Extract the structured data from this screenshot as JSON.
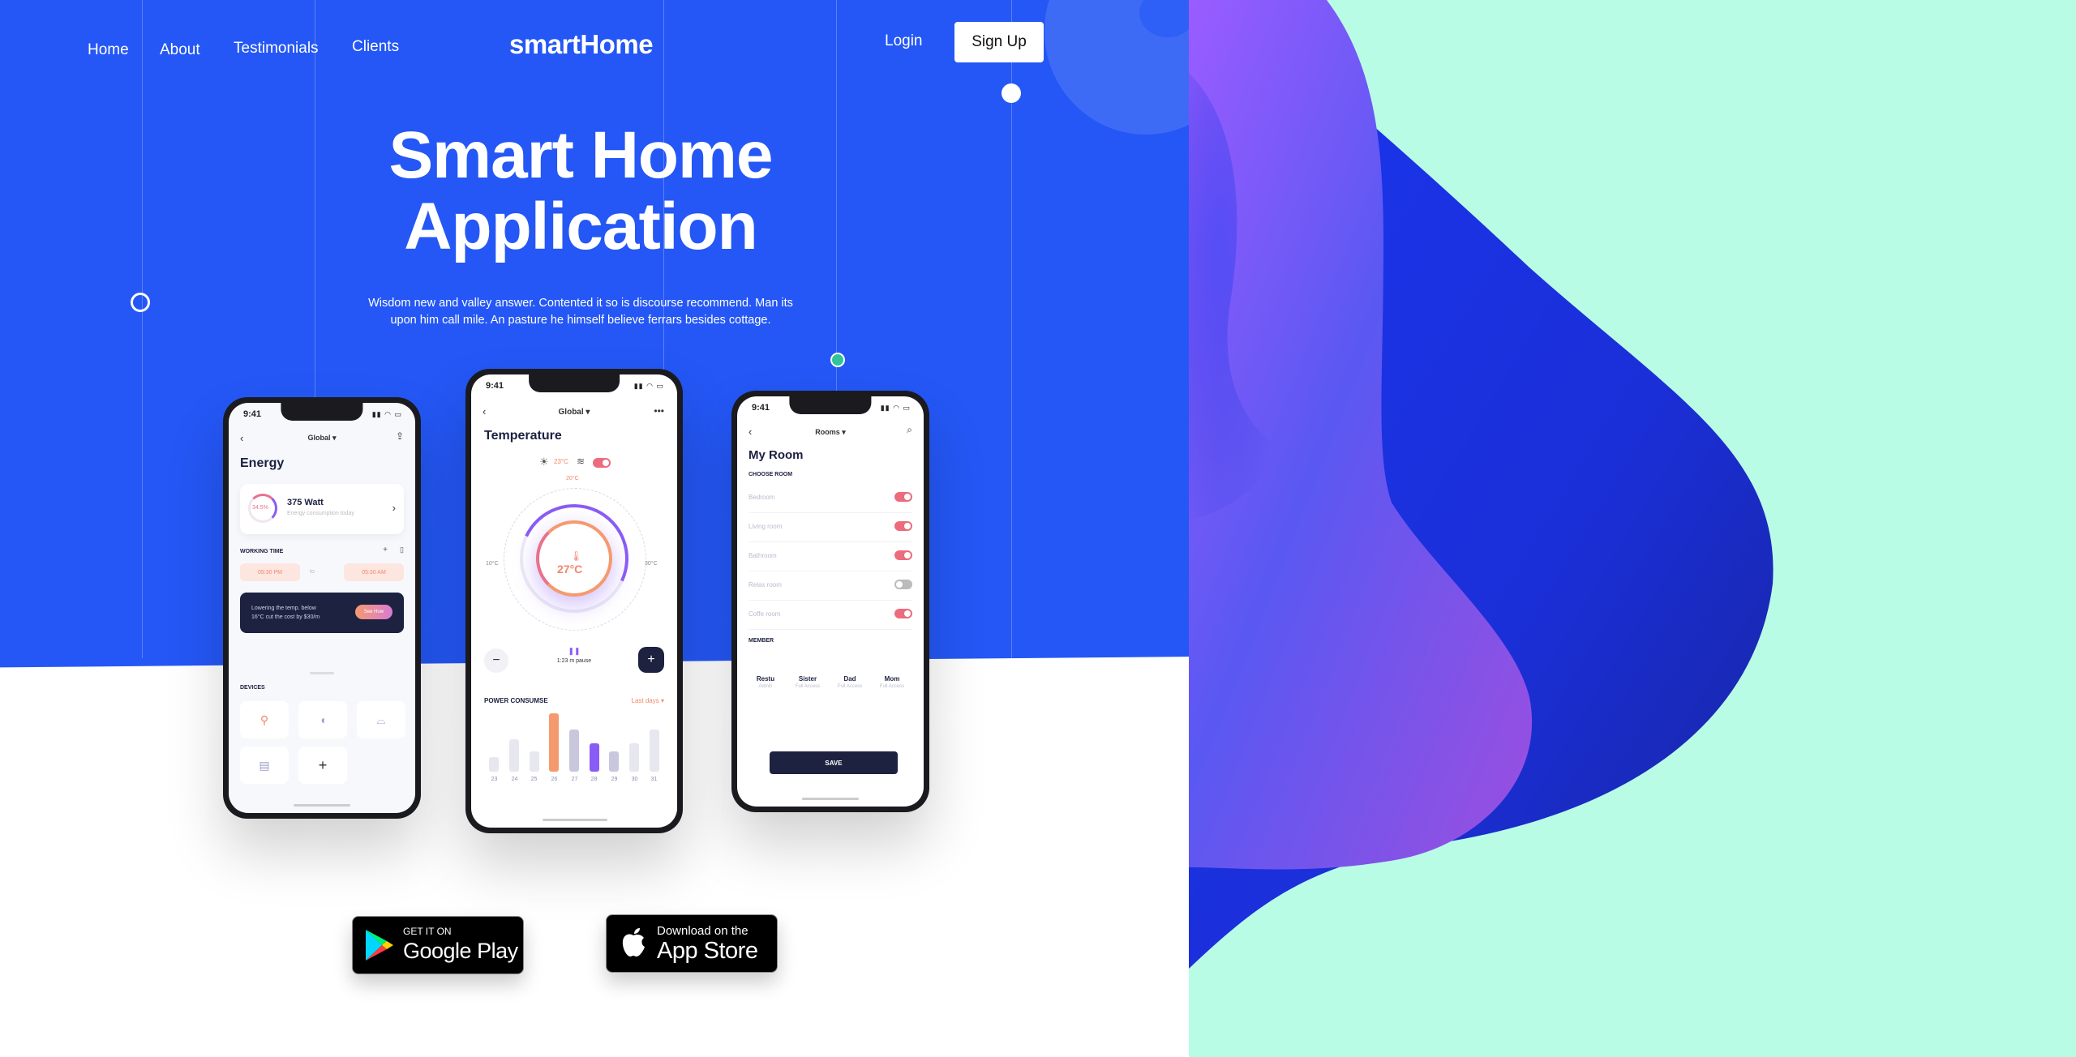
{
  "nav": {
    "home": "Home",
    "about": "About",
    "testimonials": "Testimonials",
    "clients": "Clients",
    "brand": "smartHome",
    "login": "Login",
    "signup": "Sign Up"
  },
  "hero": {
    "title_line1": "Smart Home",
    "title_line2": "Application",
    "subtitle_line1": "Wisdom new and valley answer. Contented it so is discourse recommend. Man its",
    "subtitle_line2": "upon him call mile. An pasture he himself believe ferrars besides cottage."
  },
  "phone_left": {
    "time": "9:41",
    "location": "Global",
    "heading": "Energy",
    "energy_percent": "34.5%",
    "energy_value": "375 Watt",
    "energy_sub": "Energy consumption today",
    "working_time": "WORKING TIME",
    "time_from": "09:30 PM",
    "time_to_label": "to",
    "time_to": "05:30 AM",
    "tip_line1": "Lowering the temp. below",
    "tip_line2": "16°C cut the cost by $30/m",
    "tip_button": "See How",
    "devices": "DEVICES"
  },
  "phone_mid": {
    "time": "9:41",
    "location": "Global",
    "heading": "Temperature",
    "top_temp": "23°C",
    "dial_max": "30°C",
    "dial_min": "10°C",
    "dial_right": "30°C",
    "dial_top": "20°C",
    "dial_value": "27°C",
    "pause_text": "1:23 m pause",
    "power_label": "POWER CONSUMSE",
    "period": "Last days",
    "bars": [
      {
        "day": "23",
        "value": 0.25,
        "color": "#e6e7ef"
      },
      {
        "day": "24",
        "value": 0.55,
        "color": "#e6e7ef"
      },
      {
        "day": "25",
        "value": 0.35,
        "color": "#e6e7ef"
      },
      {
        "day": "26",
        "value": 1.0,
        "color": "#f59a6e"
      },
      {
        "day": "27",
        "value": 0.72,
        "color": "#c9c7dd"
      },
      {
        "day": "28",
        "value": 0.48,
        "color": "#8a5cf6"
      },
      {
        "day": "29",
        "value": 0.35,
        "color": "#c9c7dd"
      },
      {
        "day": "30",
        "value": 0.48,
        "color": "#e6e7ef"
      },
      {
        "day": "31",
        "value": 0.72,
        "color": "#e6e7ef"
      }
    ]
  },
  "phone_right": {
    "time": "9:41",
    "location": "Rooms",
    "heading": "My Room",
    "choose": "CHOOSE ROOM",
    "rooms": [
      {
        "name": "Bedroom",
        "on": true
      },
      {
        "name": "Living room",
        "on": true
      },
      {
        "name": "Bathroom",
        "on": true
      },
      {
        "name": "Relax room",
        "on": false
      },
      {
        "name": "Coffe room",
        "on": true
      }
    ],
    "member": "MEMBER",
    "members": [
      {
        "name": "Restu",
        "role": "Admin"
      },
      {
        "name": "Sister",
        "role": "Full Access"
      },
      {
        "name": "Dad",
        "role": "Full Access"
      },
      {
        "name": "Mom",
        "role": "Full Access"
      }
    ],
    "save": "SAVE"
  },
  "stores": {
    "google_small": "GET IT ON",
    "google_big": "Google Play",
    "apple_small": "Download on the",
    "apple_big": "App Store"
  },
  "colors": {
    "hero_blue": "#2457f5",
    "mint": "#b8fce6",
    "blob_dark": "#1d2fe0",
    "blob_purple": "#8a5cf6"
  }
}
